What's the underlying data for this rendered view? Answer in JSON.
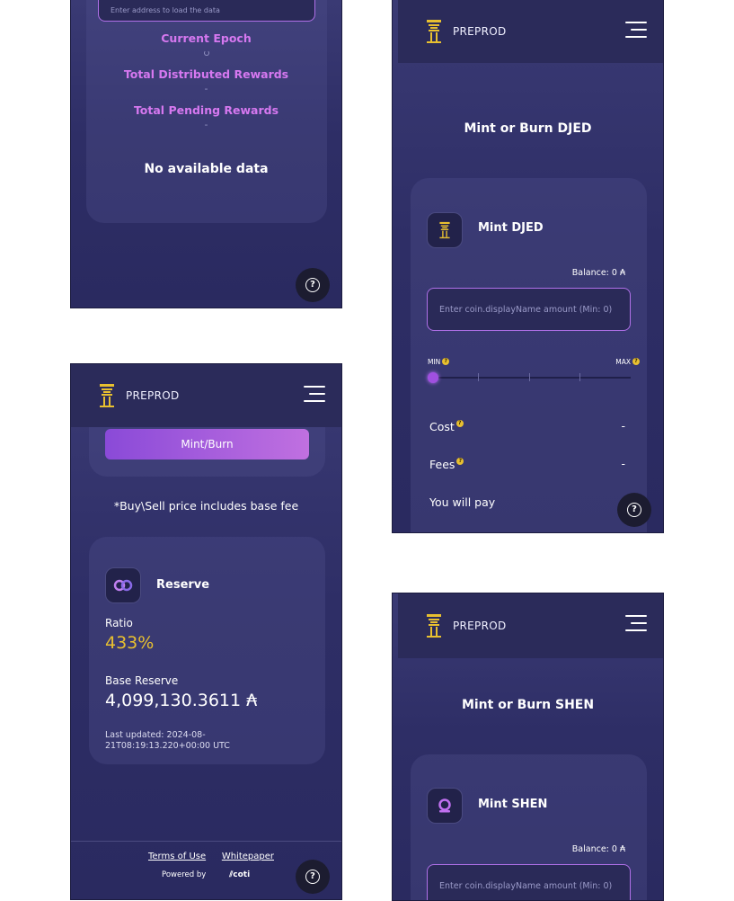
{
  "colors": {
    "bg": "#2e2e66",
    "header": "#2b2b5a",
    "accent_pink": "#d678f0",
    "accent_yellow": "#e8c030",
    "button_gradient": [
      "#8a4ad8",
      "#c070e0"
    ]
  },
  "panel1": {
    "address_placeholder": "Enter address to load the data",
    "current_epoch_label": "Current Epoch",
    "current_epoch_value": "",
    "total_distributed_label": "Total Distributed Rewards",
    "total_distributed_value": "-",
    "total_pending_label": "Total Pending Rewards",
    "total_pending_value": "-",
    "no_data": "No available data",
    "help_icon": "question-icon"
  },
  "panel2": {
    "network": "PREPROD",
    "button_label": "Mint/Burn",
    "price_note": "*Buy\\Sell price includes base fee",
    "reserve_title": "Reserve",
    "ratio_label": "Ratio",
    "ratio_value": "433%",
    "base_reserve_label": "Base Reserve",
    "base_reserve_value": "4,099,130.3611 ₳",
    "last_updated": "Last updated: 2024-08-21T08:19:13.220+00:00 UTC",
    "terms_link": "Terms of Use",
    "whitepaper_link": "Whitepaper",
    "powered_by": "Powered by",
    "brand": "coti"
  },
  "panel3": {
    "network": "PREPROD",
    "page_title": "Mint or Burn DJED",
    "card_title": "Mint DJED",
    "balance": "Balance: 0 ₳",
    "input_placeholder": "Enter coin.displayName amount (Min: 0)",
    "slider_min": "MIN",
    "slider_max": "MAX",
    "slider_value": 0,
    "cost_label": "Cost",
    "cost_value": "-",
    "fees_label": "Fees",
    "fees_value": "-",
    "pay_label": "You will pay"
  },
  "panel4": {
    "network": "PREPROD",
    "page_title": "Mint or Burn SHEN",
    "card_title": "Mint SHEN",
    "balance": "Balance: 0 ₳",
    "input_placeholder": "Enter coin.displayName amount (Min: 0)"
  }
}
